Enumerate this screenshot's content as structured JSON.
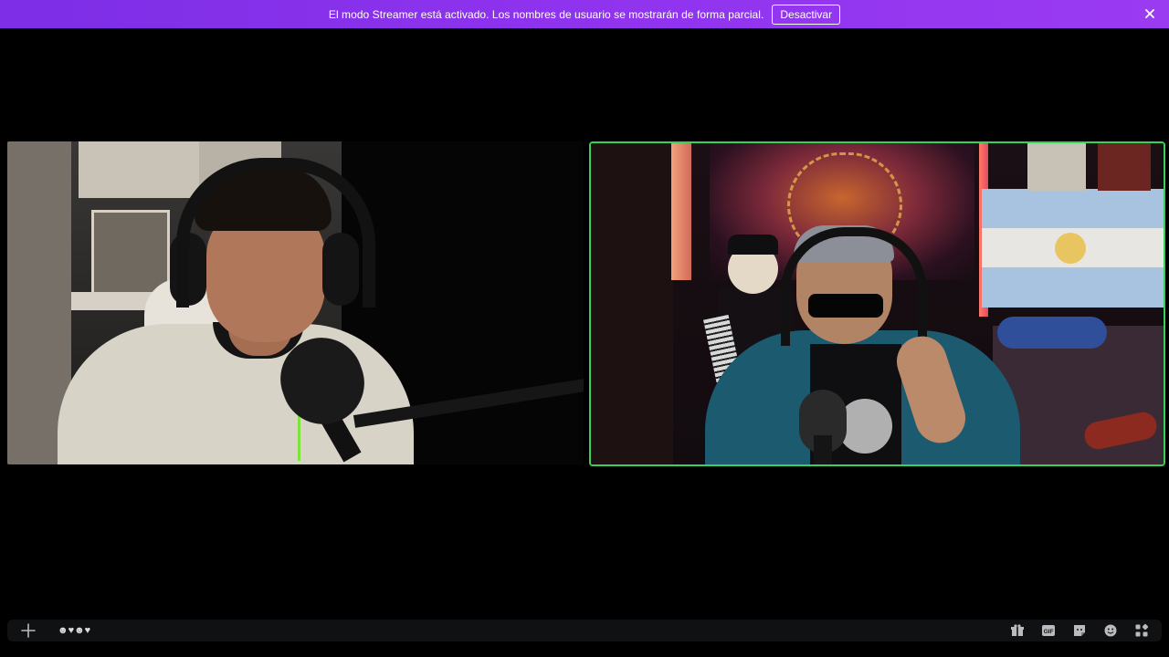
{
  "banner": {
    "message": "El modo Streamer está activado. Los nombres de usuario se mostrarán de forma parcial.",
    "button_label": "Desactivar"
  },
  "participants": [
    {
      "id": "left",
      "speaking": false
    },
    {
      "id": "right",
      "speaking": true
    }
  ],
  "composer": {
    "message_text": "☻♥☻♥",
    "icons": [
      "plus-icon",
      "gift-icon",
      "gif-icon",
      "sticker-icon",
      "emoji-icon",
      "apps-icon"
    ]
  },
  "colors": {
    "banner_bg": "#8a2be2",
    "speaking_ring": "#3ad15a",
    "composer_bg": "#101112"
  }
}
